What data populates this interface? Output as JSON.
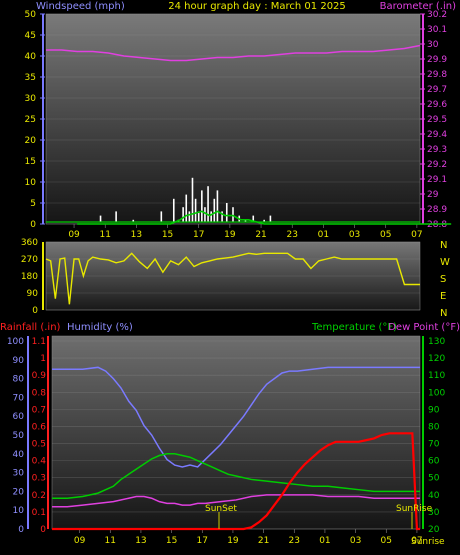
{
  "chart_data": [
    {
      "type": "line",
      "title": "24 hour graph day : March 01 2025",
      "ylabel_left": "Windspeed (mph)",
      "ylabel_right": "Barometer (.in)",
      "ylim_left": [
        0,
        50
      ],
      "ylim_right": [
        28.8,
        30.2
      ],
      "yticks_left": [
        "0",
        "5",
        "10",
        "15",
        "20",
        "25",
        "30",
        "35",
        "40",
        "45",
        "50"
      ],
      "yticks_right": [
        "28.8",
        "28.9",
        "29",
        "29.1",
        "29.2",
        "29.3",
        "29.4",
        "29.5",
        "29.6",
        "29.7",
        "29.8",
        "29.9",
        "30",
        "30.1",
        "30.2"
      ],
      "xticks": [
        "09",
        "11",
        "13",
        "15",
        "17",
        "19",
        "21",
        "23",
        "01",
        "03",
        "05",
        "07"
      ],
      "series": [
        {
          "name": "Barometer",
          "axis": "right",
          "color": "#e040e0",
          "x": [
            0,
            1,
            2,
            3,
            4,
            5,
            6,
            7,
            8,
            9,
            10,
            11,
            12,
            13,
            14,
            15,
            16,
            17,
            18,
            19,
            20,
            21,
            22,
            23,
            24
          ],
          "values": [
            29.96,
            29.96,
            29.95,
            29.95,
            29.94,
            29.92,
            29.91,
            29.9,
            29.89,
            29.89,
            29.9,
            29.91,
            29.91,
            29.92,
            29.92,
            29.93,
            29.94,
            29.94,
            29.94,
            29.95,
            29.95,
            29.95,
            29.96,
            29.97,
            29.99
          ]
        },
        {
          "name": "Wind gust",
          "axis": "left",
          "color": "#ffffff",
          "x": [
            0,
            1,
            1.5,
            2,
            2.5,
            3,
            3.6,
            4,
            4.3,
            4.6,
            5,
            5.4,
            5.8,
            6.2,
            6.5,
            6.8,
            7,
            7.2,
            7.4,
            7.6,
            7.8,
            8,
            8.2,
            8.4,
            8.6,
            8.8,
            9,
            9.3,
            9.6,
            10,
            10.4,
            10.8,
            11.3,
            11.8,
            12,
            12.4,
            13,
            14,
            14.5,
            15,
            15.5,
            16,
            16.5,
            17,
            18,
            19,
            20,
            21,
            22,
            23,
            24
          ],
          "values": [
            0,
            0,
            2,
            0,
            3,
            0,
            1,
            0,
            0,
            0,
            0,
            3,
            0,
            6,
            1,
            4,
            7,
            3,
            11,
            6,
            3,
            8,
            4,
            9,
            3,
            6,
            8,
            3,
            5,
            4,
            2,
            1,
            2,
            0,
            1,
            2,
            0,
            0,
            0,
            0,
            0,
            0,
            0,
            0,
            0,
            0,
            0,
            0,
            0,
            0,
            0
          ]
        },
        {
          "name": "Wind speed",
          "axis": "left",
          "color": "#00cc00",
          "x": [
            0,
            6,
            6.6,
            7,
            7.5,
            8,
            8.5,
            9,
            9.5,
            10,
            10.5,
            11,
            11.5,
            12,
            24
          ],
          "values": [
            0,
            0,
            1,
            2,
            2.5,
            3,
            2,
            3,
            2,
            2,
            1,
            1,
            0.5,
            0,
            0
          ]
        }
      ]
    },
    {
      "type": "line",
      "title": "",
      "ylabel_right": "N W S E N",
      "ylim": [
        0,
        360
      ],
      "yticks": [
        "0",
        "90",
        "180",
        "270",
        "360"
      ],
      "series": [
        {
          "name": "Wind direction",
          "color": "#e8e800",
          "x": [
            0,
            0.3,
            0.6,
            0.9,
            1.2,
            1.5,
            1.8,
            2.1,
            2.4,
            2.7,
            3,
            3.5,
            4,
            4.5,
            5,
            5.5,
            6,
            6.5,
            7,
            7.5,
            8,
            8.5,
            9,
            9.5,
            10,
            10.5,
            11,
            11.5,
            12,
            12.5,
            13,
            13.5,
            14,
            14.5,
            15,
            15.5,
            16,
            16.5,
            17,
            17.5,
            18,
            18.5,
            19,
            19.5,
            20,
            20.5,
            21,
            21.5,
            22,
            22.5,
            23,
            23.5,
            24
          ],
          "values": [
            270,
            260,
            60,
            270,
            275,
            30,
            270,
            270,
            180,
            260,
            280,
            270,
            265,
            250,
            260,
            300,
            255,
            220,
            270,
            200,
            260,
            240,
            280,
            230,
            250,
            260,
            270,
            275,
            280,
            290,
            300,
            295,
            300,
            300,
            300,
            300,
            270,
            270,
            220,
            260,
            270,
            280,
            270,
            270,
            270,
            270,
            270,
            270,
            270,
            270,
            135,
            135,
            135
          ]
        }
      ]
    },
    {
      "type": "line",
      "title": "",
      "ylabel_left_1": "Rainfall (.in)",
      "ylabel_left_2": "Humidity (%)",
      "ylabel_right_1": "Temperature (°F)",
      "ylabel_right_2": "Dew Point (°F)",
      "ylim_rain": [
        0,
        1.1
      ],
      "ylim_humidity": [
        0,
        100
      ],
      "ylim_temp": [
        20,
        130
      ],
      "yticks_humidity": [
        "0",
        "10",
        "20",
        "30",
        "40",
        "50",
        "60",
        "70",
        "80",
        "90",
        "100"
      ],
      "yticks_rain": [
        "0",
        "0.1",
        "0.2",
        "0.3",
        "0.4",
        "0.5",
        "0.6",
        "0.7",
        "0.8",
        "0.9",
        "1",
        "1.1"
      ],
      "yticks_temp": [
        "20",
        "30",
        "40",
        "50",
        "60",
        "70",
        "80",
        "90",
        "100",
        "110",
        "120",
        "130"
      ],
      "xticks": [
        "09",
        "11",
        "13",
        "15",
        "17",
        "19",
        "21",
        "23",
        "01",
        "03",
        "05",
        "07"
      ],
      "annotations": [
        "SunSet",
        "SunRise",
        "Sunrise"
      ],
      "series": [
        {
          "name": "Humidity",
          "axis": "humidity",
          "color": "#7a7aff",
          "x": [
            0,
            1,
            2,
            3,
            3.5,
            4,
            4.5,
            5,
            5.5,
            6,
            6.5,
            7,
            7.5,
            8,
            8.5,
            9,
            9.5,
            10,
            10.5,
            11,
            11.5,
            12,
            12.5,
            13,
            13.5,
            14,
            14.5,
            15,
            15.5,
            16,
            17,
            18,
            19,
            20,
            21,
            22,
            23,
            24
          ],
          "values": [
            85,
            85,
            85,
            86,
            84,
            80,
            75,
            68,
            63,
            55,
            50,
            43,
            37,
            34,
            33,
            34,
            33,
            37,
            41,
            45,
            50,
            55,
            60,
            66,
            72,
            77,
            80,
            83,
            84,
            84,
            85,
            86,
            86,
            86,
            86,
            86,
            86,
            86
          ]
        },
        {
          "name": "Temperature",
          "axis": "temp",
          "color": "#00cc00",
          "x": [
            0,
            1,
            2,
            3,
            3.5,
            4,
            4.5,
            5,
            5.5,
            6,
            6.5,
            7,
            7.5,
            8,
            8.5,
            9,
            9.5,
            10,
            10.5,
            11,
            11.5,
            12,
            13,
            14,
            15,
            16,
            17,
            18,
            19,
            20,
            21,
            22,
            23,
            24
          ],
          "values": [
            38,
            38,
            39,
            41,
            43,
            45,
            49,
            52,
            55,
            58,
            61,
            63,
            64,
            64,
            63,
            62,
            60,
            58,
            56,
            54,
            52,
            51,
            49,
            48,
            47,
            46,
            45,
            45,
            44,
            43,
            42,
            42,
            42,
            42
          ]
        },
        {
          "name": "Dew Point",
          "axis": "temp",
          "color": "#e040e0",
          "x": [
            0,
            1,
            2,
            3,
            4,
            5,
            5.5,
            6,
            6.5,
            7,
            7.5,
            8,
            8.5,
            9,
            9.5,
            10,
            11,
            12,
            13,
            14,
            15,
            16,
            17,
            18,
            19,
            20,
            21,
            22,
            23,
            24
          ],
          "values": [
            33,
            33,
            34,
            35,
            36,
            38,
            39,
            39,
            38,
            36,
            35,
            35,
            34,
            34,
            35,
            35,
            36,
            37,
            39,
            40,
            40,
            40,
            40,
            39,
            39,
            39,
            38,
            38,
            38,
            38
          ]
        },
        {
          "name": "Rainfall",
          "axis": "rain",
          "color": "#ff0000",
          "x": [
            0,
            12,
            12.5,
            13,
            13.5,
            14,
            14.5,
            15,
            15.5,
            16,
            16.5,
            17,
            17.5,
            18,
            18.5,
            19,
            19.5,
            20,
            20.5,
            21,
            21.5,
            22,
            22.5,
            23,
            23.5,
            23.8,
            24
          ],
          "values": [
            0,
            0,
            0,
            0.01,
            0.04,
            0.08,
            0.14,
            0.2,
            0.27,
            0.33,
            0.38,
            0.42,
            0.46,
            0.49,
            0.51,
            0.51,
            0.51,
            0.51,
            0.52,
            0.53,
            0.55,
            0.56,
            0.56,
            0.56,
            0.56,
            0,
            0
          ]
        }
      ]
    }
  ]
}
